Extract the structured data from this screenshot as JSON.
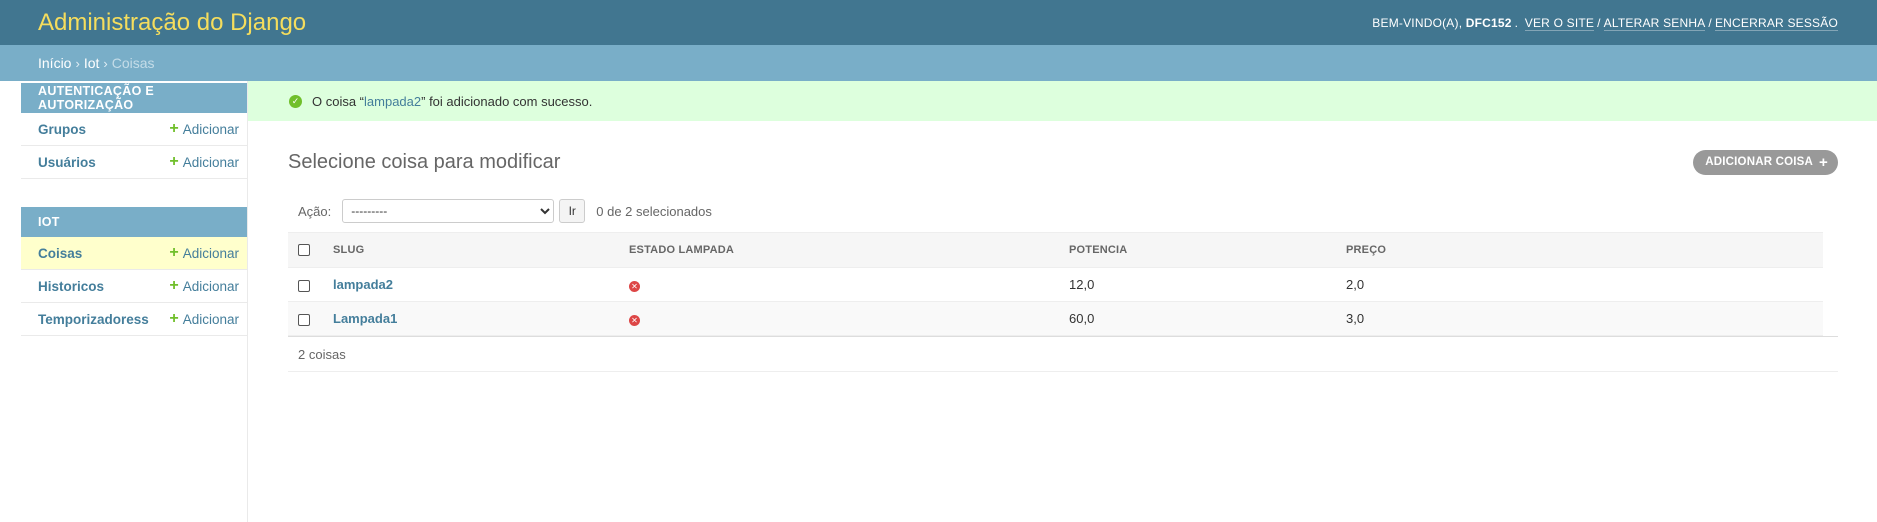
{
  "header": {
    "branding": "Administração do Django",
    "welcome": "BEM-VINDO(A),",
    "username": "DFC152",
    "view_site": "VER O SITE",
    "change_password": "ALTERAR SENHA",
    "logout": "ENCERRAR SESSÃO"
  },
  "breadcrumbs": {
    "home": "Início",
    "app": "Iot",
    "current": "Coisas"
  },
  "sidebar": {
    "modules": [
      {
        "caption": "AUTENTICAÇÃO E AUTORIZAÇÃO",
        "models": [
          {
            "name": "Grupos",
            "add": "Adicionar"
          },
          {
            "name": "Usuários",
            "add": "Adicionar"
          }
        ]
      },
      {
        "caption": "IOT",
        "models": [
          {
            "name": "Coisas",
            "add": "Adicionar",
            "current": true
          },
          {
            "name": "Historicos",
            "add": "Adicionar"
          },
          {
            "name": "Temporizadoress",
            "add": "Adicionar"
          }
        ]
      }
    ]
  },
  "message": {
    "prefix": "O coisa “",
    "link": "lampada2",
    "suffix": "” foi adicionado com sucesso."
  },
  "main": {
    "title": "Selecione coisa para modificar",
    "add_button": "ADICIONAR COISA",
    "action_label": "Ação:",
    "action_selected": "---------",
    "go_button": "Ir",
    "selected_count": "0 de 2 selecionados",
    "columns": [
      "SLUG",
      "ESTADO LAMPADA",
      "POTENCIA",
      "PREÇO"
    ],
    "rows": [
      {
        "slug": "lampada2",
        "estado": false,
        "potencia": "12,0",
        "preco": "2,0"
      },
      {
        "slug": "Lampada1",
        "estado": false,
        "potencia": "60,0",
        "preco": "3,0"
      }
    ],
    "paginator": "2 coisas"
  },
  "colors": {
    "header_bg": "#417690",
    "branding": "#f5dd5d",
    "breadcrumbs_bg": "#79aec8",
    "link": "#447e9b",
    "success_bg": "#ddffdd",
    "current_row_bg": "#ffffcc"
  }
}
